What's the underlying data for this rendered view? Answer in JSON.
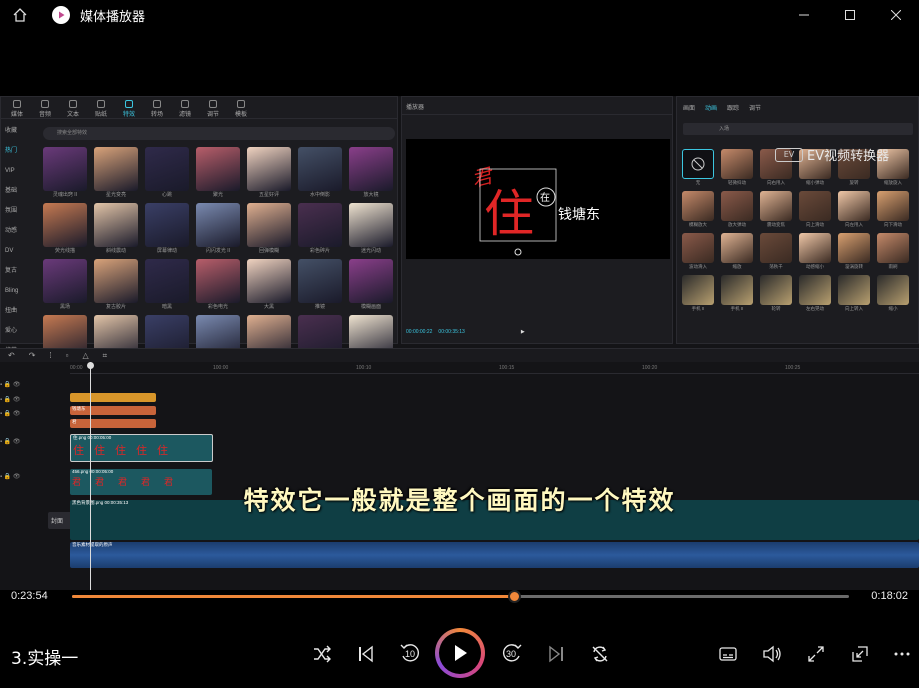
{
  "window": {
    "title": "媒体播放器",
    "controls": [
      "minimize",
      "maximize",
      "close"
    ]
  },
  "editor": {
    "media_tabs": [
      "媒体",
      "音频",
      "文本",
      "贴纸",
      "特效",
      "转场",
      "滤镜",
      "调节",
      "模板"
    ],
    "active_tab": "特效",
    "categories": [
      "收藏",
      "热门",
      "VIP",
      "基础",
      "氛围",
      "动感",
      "DV",
      "复古",
      "Bling",
      "扭曲",
      "爱心",
      "综艺"
    ],
    "active_category": "热门",
    "search_placeholder": "搜索全部特效",
    "effects_row_labels": [
      [
        "灵魂出窍 II",
        "星光变亮",
        "心跳",
        "聚光",
        "五星好评",
        "水中倒影",
        "放大镜"
      ],
      [
        "荧光线描",
        "斜线震动",
        "屏幕律动",
        "闪闪发光 II",
        "回弹模糊",
        "彩色碎片",
        "迷光闪动"
      ],
      [
        "黑场",
        "复古胶片",
        "暗黑",
        "彩色电光",
        "大黑",
        "推镜",
        "模糊画面"
      ],
      [
        "",
        "",
        "",
        "",
        "",
        "",
        ""
      ]
    ],
    "player_title": "播放器",
    "player_time_current": "00:00:00:22",
    "player_time_total": "00:00:35:13",
    "player_text_main": "住",
    "player_text_sub": "钱塘东",
    "right_tabs": [
      "画面",
      "动画",
      "跟踪",
      "调节"
    ],
    "right_active_tab": "动画",
    "right_sub_tab": "入场",
    "watermark": "EV视频转换器",
    "watermark_logo": "EV",
    "anim_labels": [
      [
        "无",
        "轻微抖动",
        "向右甩入",
        "缩小弹动",
        "旋转",
        "缩放旋入"
      ],
      [
        "模糊放大",
        "放大弹动",
        "震动变焦",
        "向上滑动",
        "向左甩入",
        "向下滑动"
      ],
      [
        "波动滑入",
        "缩放",
        "荡秋千",
        "动感缩小",
        "漩涡旋转",
        "雨刷"
      ],
      [
        "手机 II",
        "手机 II",
        "轮转",
        "左右晃动",
        "向上转入",
        "缩小"
      ]
    ],
    "ruler_marks": [
      "00:00",
      "100:00",
      "100:10",
      "100:15",
      "100:20",
      "100:25"
    ],
    "tracks": [
      {
        "label": "文本",
        "clip": ""
      },
      {
        "label": "",
        "clip": "钱塘东"
      },
      {
        "label": "",
        "clip": "君"
      },
      {
        "label": "",
        "clip": "住.png  00:00:05:00"
      },
      {
        "label": "",
        "clip": "456.png  00:00:05:00"
      },
      {
        "label": "封面",
        "clip": "黑色背景图.png  00:00:35:13"
      },
      {
        "label": "",
        "clip": "音乐素材提取的原声"
      }
    ],
    "cover_label": "封面"
  },
  "subtitle": "特效它一般就是整个画面的一个特效",
  "player": {
    "time_elapsed": "0:23:54",
    "time_remaining": "0:18:02",
    "progress_fraction": 0.569,
    "now_playing": "3.实操一",
    "accent": "#f0883a"
  },
  "controls": {
    "shuffle_icon": "shuffle-icon",
    "previous_icon": "previous-icon",
    "rewind_label": "10",
    "forward_label": "30",
    "next_icon": "next-icon",
    "repeat_icon": "repeat-icon",
    "subtitles_icon": "subtitles-icon",
    "volume_icon": "volume-icon",
    "fullscreen_icon": "fullscreen-icon",
    "miniplayer_icon": "miniplayer-icon",
    "more_icon": "more-icon"
  }
}
